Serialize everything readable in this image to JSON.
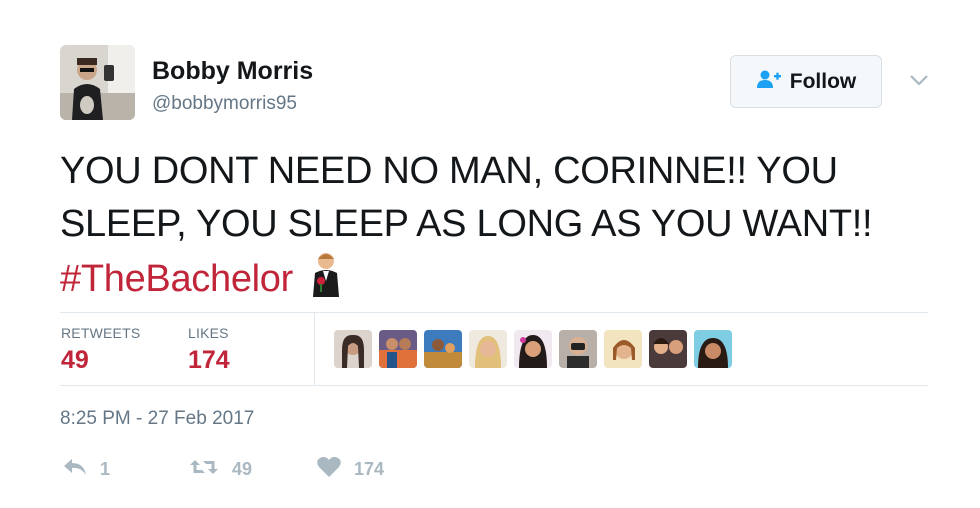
{
  "author": {
    "name": "Bobby Morris",
    "handle": "@bobbymorris95"
  },
  "follow_button": {
    "label": "Follow"
  },
  "tweet": {
    "text_line1": "YOU DONT NEED NO MAN, CORINNE!! YOU",
    "text_line2": "SLEEP, YOU SLEEP AS LONG AS YOU WANT!!",
    "hashtag": "#TheBachelor",
    "emoji": "rose-bachelor-emoji"
  },
  "stats": {
    "retweets_label": "RETWEETS",
    "retweets_value": "49",
    "likes_label": "LIKES",
    "likes_value": "174"
  },
  "timestamp": "8:25 PM - 27 Feb 2017",
  "actions": {
    "reply_count": "1",
    "retweet_count": "49",
    "like_count": "174"
  },
  "colors": {
    "accent": "#c0253a",
    "muted": "#657786",
    "action_icon": "#aab8c2",
    "divider": "#e1e8ed"
  }
}
